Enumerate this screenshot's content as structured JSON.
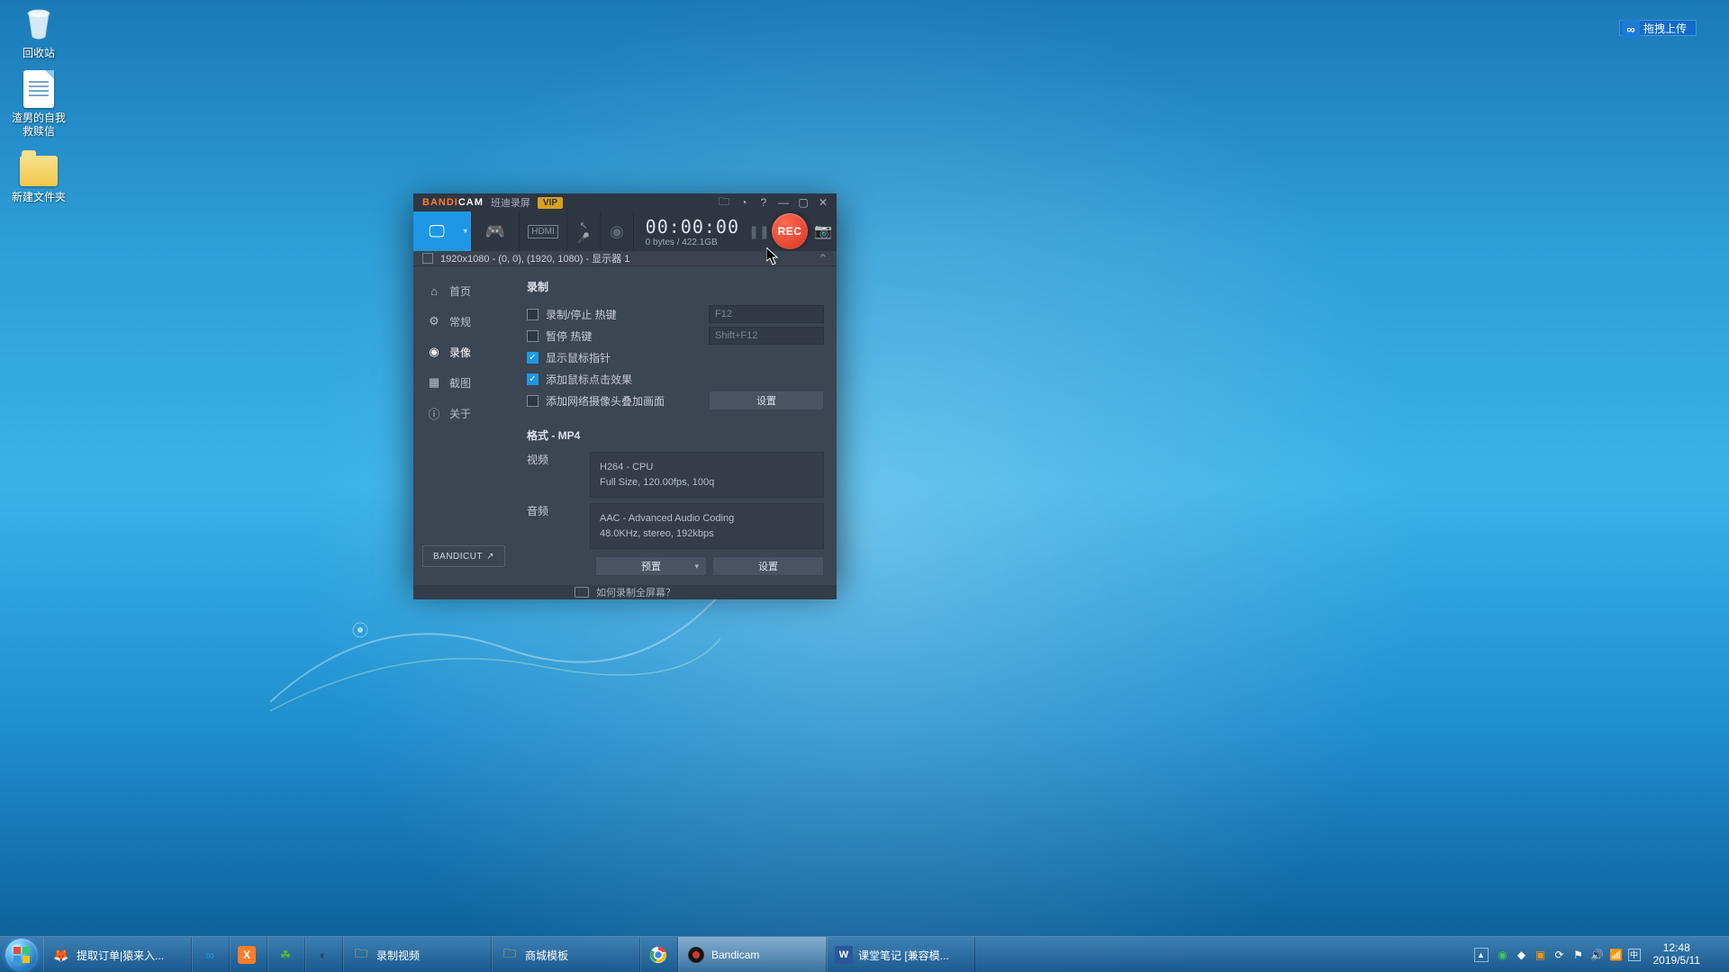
{
  "desktop": {
    "icons": [
      {
        "name": "recycle-bin",
        "label": "回收站"
      },
      {
        "name": "doc-1",
        "label": "渣男的自我救赎信"
      },
      {
        "name": "folder-1",
        "label": "新建文件夹"
      }
    ]
  },
  "cloud_widget": {
    "label": "拖拽上传"
  },
  "bandicam": {
    "brand": "BANDI",
    "brand2": "CAM",
    "subtitle": "班迪录屏",
    "vip": "VIP",
    "timer": "00:00:00",
    "size_line": "0 bytes / 422.1GB",
    "rec_label": "REC",
    "infobar": "1920x1080 - (0, 0), (1920, 1080) - 显示器 1",
    "sidebar": {
      "home": "首页",
      "general": "常规",
      "record": "录像",
      "capture": "截图",
      "about": "关于",
      "bandicut": "BANDICUT"
    },
    "record_section": {
      "title": "录制",
      "opt_hotkey": "录制/停止 热键",
      "opt_hotkey_val": "F12",
      "opt_pause": "暂停 热键",
      "opt_pause_val": "Shift+F12",
      "opt_cursor": "显示鼠标指针",
      "opt_click": "添加鼠标点击效果",
      "opt_webcam": "添加网络摄像头叠加画面",
      "settings_btn": "设置"
    },
    "format_section": {
      "title": "格式 - MP4",
      "video_label": "视频",
      "video_line1": "H264 - CPU",
      "video_line2": "Full Size, 120.00fps, 100q",
      "audio_label": "音频",
      "audio_line1": "AAC - Advanced Audio Coding",
      "audio_line2": "48.0KHz, stereo, 192kbps",
      "preset_btn": "预置",
      "settings_btn": "设置"
    },
    "footer_help": "如何录制全屏幕？"
  },
  "taskbar": {
    "items": [
      {
        "label": "提取订单|猿来入...",
        "kind": "firefox"
      },
      {
        "label": "",
        "kind": "baidu"
      },
      {
        "label": "",
        "kind": "xampp"
      },
      {
        "label": "",
        "kind": "php"
      },
      {
        "label": "",
        "kind": "eclipse"
      },
      {
        "label": "录制视频",
        "kind": "explorer"
      },
      {
        "label": "商城模板",
        "kind": "explorer"
      },
      {
        "label": "",
        "kind": "chrome"
      },
      {
        "label": "Bandicam",
        "kind": "bandicam"
      },
      {
        "label": "课堂笔记 [兼容模...",
        "kind": "word"
      }
    ],
    "clock_time": "12:48",
    "clock_date": "2019/5/11"
  }
}
